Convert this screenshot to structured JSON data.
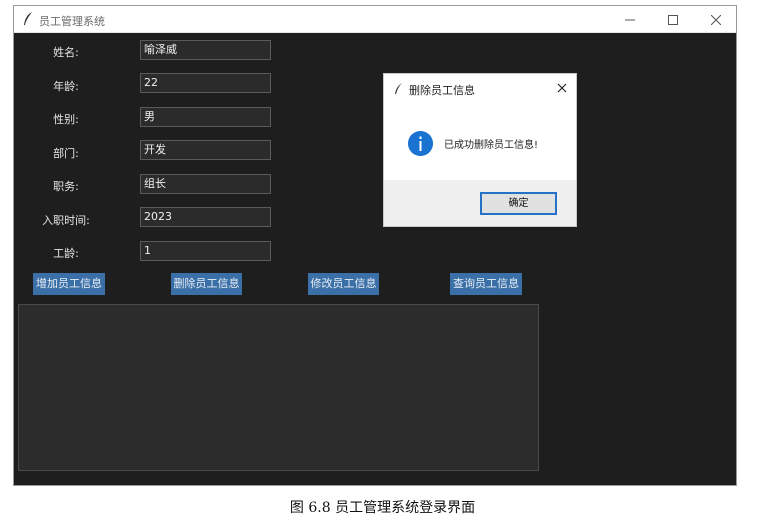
{
  "window": {
    "title": "员工管理系统",
    "icon": "feather-icon",
    "controls": [
      "minimize-icon",
      "maximize-icon",
      "close-icon"
    ]
  },
  "form": {
    "fields": [
      {
        "label": "姓名:",
        "value": "喻泽威"
      },
      {
        "label": "年龄:",
        "value": "22"
      },
      {
        "label": "性别:",
        "value": "男"
      },
      {
        "label": "部门:",
        "value": "开发"
      },
      {
        "label": "职务:",
        "value": "组长"
      },
      {
        "label": "入职时间:",
        "value": "2023"
      },
      {
        "label": "工龄:",
        "value": "1"
      }
    ]
  },
  "buttons": {
    "add": "增加员工信息",
    "delete": "删除员工信息",
    "modify": "修改员工信息",
    "query": "查询员工信息"
  },
  "output": {
    "text": ""
  },
  "dialog": {
    "title": "删除员工信息",
    "message": "已成功删除员工信息!",
    "ok": "确定",
    "icon": "info-icon"
  },
  "caption": "图 6.8  员工管理系统登录界面",
  "colors": {
    "window_bg": "#1e1e1e",
    "button_bg": "#3b6fa7",
    "info_icon": "#1a73d1",
    "dialog_button_border": "#2672c8"
  }
}
